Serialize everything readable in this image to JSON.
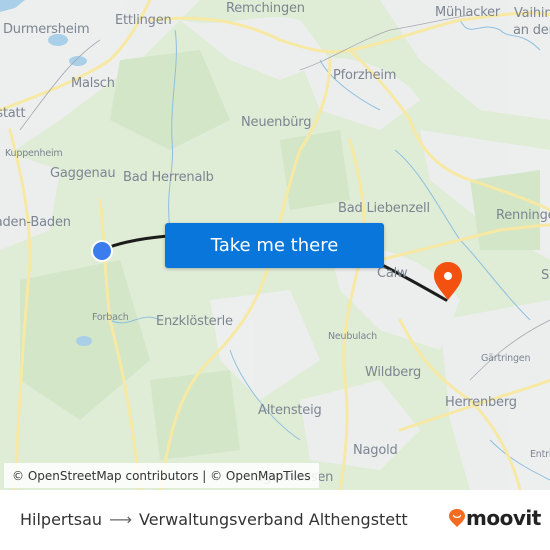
{
  "map": {
    "places": [
      {
        "name": "Ettlingen",
        "size": "lg"
      },
      {
        "name": "Remchingen",
        "size": "lg"
      },
      {
        "name": "Mühlacker",
        "size": "lg"
      },
      {
        "name": "Vaihingen",
        "size": "lg"
      },
      {
        "name": "an der",
        "size": "lg"
      },
      {
        "name": "Durmersheim",
        "size": "lg"
      },
      {
        "name": "Pforzheim",
        "size": "lg"
      },
      {
        "name": "Malsch",
        "size": "lg"
      },
      {
        "name": "Rastatt",
        "size": "lg"
      },
      {
        "name": "Neuenbürg",
        "size": "lg"
      },
      {
        "name": "Kuppenheim",
        "size": "sm"
      },
      {
        "name": "Gaggenau",
        "size": "lg"
      },
      {
        "name": "Bad Herrenalb",
        "size": "lg"
      },
      {
        "name": "Bad Liebenzell",
        "size": "lg"
      },
      {
        "name": "Renningen",
        "size": "lg"
      },
      {
        "name": "Baden-Baden",
        "size": "lg"
      },
      {
        "name": "Calw",
        "size": "lg"
      },
      {
        "name": "Sindelfingen",
        "size": "lg"
      },
      {
        "name": "Forbach",
        "size": "sm"
      },
      {
        "name": "Enzklösterle",
        "size": "lg"
      },
      {
        "name": "Neubulach",
        "size": "sm"
      },
      {
        "name": "Gärtringen",
        "size": "sm"
      },
      {
        "name": "Wildberg",
        "size": "lg"
      },
      {
        "name": "Herrenberg",
        "size": "lg"
      },
      {
        "name": "Altensteig",
        "size": "lg"
      },
      {
        "name": "Nagold",
        "size": "lg"
      },
      {
        "name": "Entringen",
        "size": "sm"
      },
      {
        "name": "Egenhausen",
        "size": "lg"
      }
    ],
    "cta_label": "Take me there",
    "attribution": "© OpenStreetMap contributors | © OpenMapTiles",
    "origin_marker_color": "#3b7ded",
    "destination_marker_color": "#f3510f",
    "route_color": "#1c1c1c"
  },
  "footer": {
    "origin": "Hilpertsau",
    "arrow": "⟶",
    "destination": "Verwaltungsverband Althengstett",
    "brand": "moovit",
    "brand_color": "#f26b21"
  }
}
